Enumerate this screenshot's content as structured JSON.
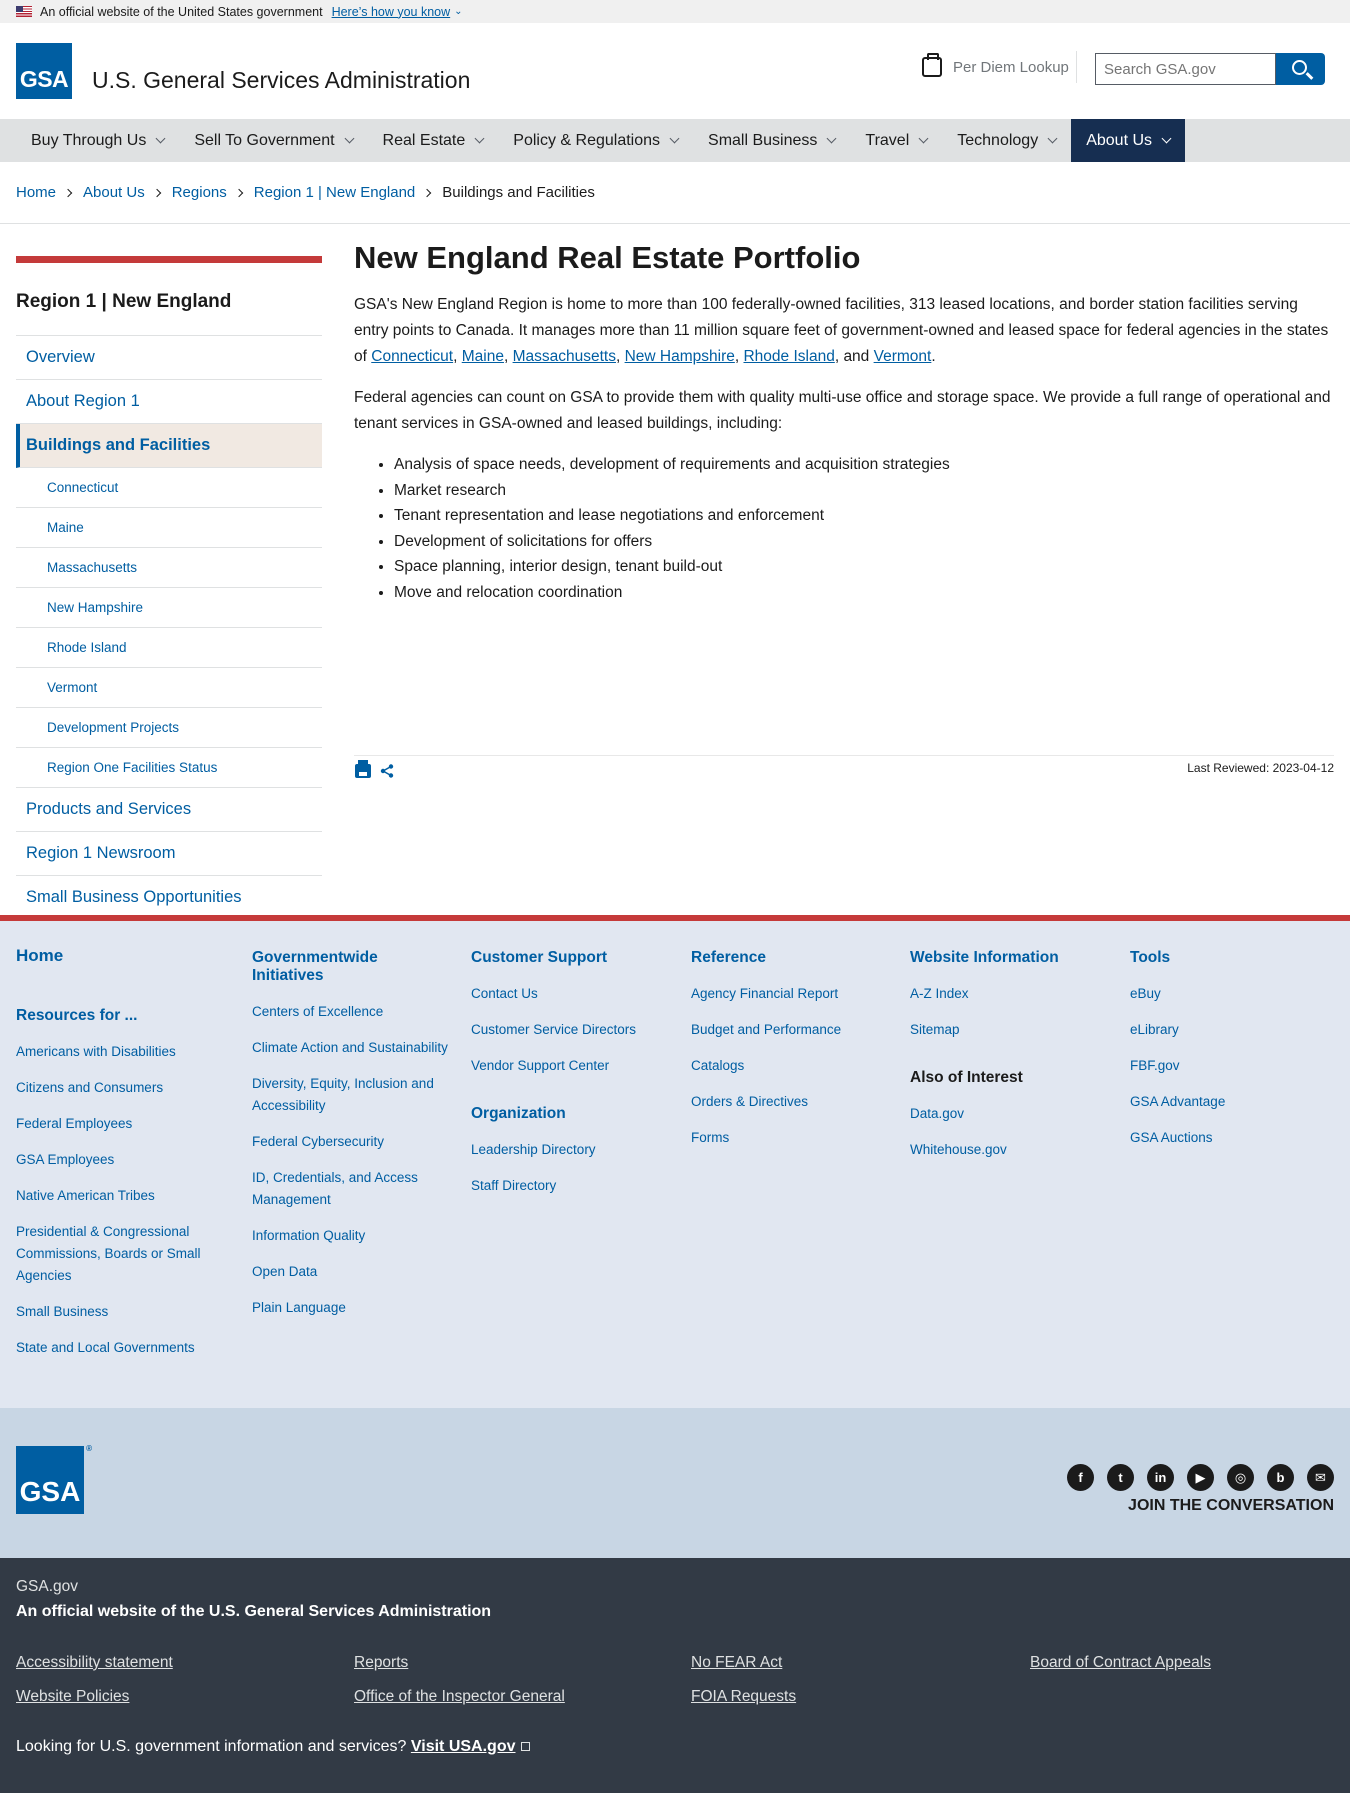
{
  "banner": {
    "text": "An official website of the United States government",
    "link": "Here’s how you know"
  },
  "header": {
    "logo": "GSA",
    "title": "U.S. General Services Administration",
    "perdiem": "Per Diem Lookup",
    "search_placeholder": "Search GSA.gov"
  },
  "nav": [
    "Buy Through Us",
    "Sell To Government",
    "Real Estate",
    "Policy & Regulations",
    "Small Business",
    "Travel",
    "Technology",
    "About Us"
  ],
  "breadcrumb": [
    "Home",
    "About Us",
    "Regions",
    "Region 1 | New England",
    "Buildings and Facilities"
  ],
  "sidenav": {
    "title": "Region 1 | New England",
    "items": [
      "Overview",
      "About Region 1",
      "Buildings and Facilities"
    ],
    "subitems": [
      "Connecticut",
      "Maine",
      "Massachusetts",
      "New Hampshire",
      "Rhode Island",
      "Vermont",
      "Development Projects",
      "Region One Facilities Status"
    ],
    "after": [
      "Products and Services",
      "Region 1 Newsroom",
      "Small Business Opportunities"
    ]
  },
  "main": {
    "title": "New England Real Estate Portfolio",
    "p1": "GSA's New England Region is home to more than 100 federally-owned facilities, 313 leased locations, and border station facilities serving entry points to Canada. It manages more than 11 million square feet of government-owned and leased space for federal agencies in the states of",
    "states": [
      "Connecticut",
      "Maine",
      "Massachusetts",
      "New Hampshire",
      "Rhode Island",
      "Vermont"
    ],
    "p2": "Federal agencies can count on GSA to provide them with quality multi-use office and storage space. We provide a full range of operational and tenant services in GSA-owned and leased buildings, including:",
    "bullets": [
      "Analysis of space needs, development of requirements and acquisition strategies",
      "Market research",
      "Tenant representation and lease negotiations and enforcement",
      "Development of solicitations for offers",
      "Space planning, interior design, tenant build-out",
      "Move and relocation coordination"
    ],
    "last_reviewed": "Last Reviewed: 2023-04-12"
  },
  "footer": {
    "home": "Home",
    "resources_title": "Resources for ...",
    "resources": [
      "Americans with Disabilities",
      "Citizens and Consumers",
      "Federal Employees",
      "GSA Employees",
      "Native American Tribes",
      "Presidential & Congressional Commissions, Boards or Small Agencies",
      "Small Business",
      "State and Local Governments"
    ],
    "gov_title": "Governmentwide Initiatives",
    "gov": [
      "Centers of Excellence",
      "Climate Action and Sustainability",
      "Diversity, Equity, Inclusion and Accessibility",
      "Federal Cybersecurity",
      "ID, Credentials, and Access Management",
      "Information Quality",
      "Open Data",
      "Plain Language"
    ],
    "cs_title": "Customer Support",
    "cs": [
      "Contact Us",
      "Customer Service Directors",
      "Vendor Support Center"
    ],
    "org_title": "Organization",
    "org": [
      "Leadership Directory",
      "Staff Directory"
    ],
    "ref_title": "Reference",
    "ref": [
      "Agency Financial Report",
      "Budget and Performance",
      "Catalogs",
      "Orders & Directives",
      "Forms"
    ],
    "web_title": "Website Information",
    "web": [
      "A-Z Index",
      "Sitemap"
    ],
    "interest_title": "Also of Interest",
    "interest": [
      "Data.gov",
      "Whitehouse.gov"
    ],
    "tools_title": "Tools",
    "tools": [
      "eBuy",
      "eLibrary",
      "FBF.gov",
      "GSA Advantage",
      "GSA Auctions"
    ]
  },
  "identifier": {
    "join": "JOIN THE CONVERSATION",
    "social": [
      "f",
      "t",
      "in",
      "▶",
      "◎",
      "b",
      "✉"
    ]
  },
  "bottom": {
    "gsagov": "GSA.gov",
    "official": "An official website of the U.S. General Services Administration",
    "links": [
      "Accessibility statement",
      "Reports",
      "No FEAR Act",
      "Board of Contract Appeals",
      "Website Policies",
      "Office of the Inspector General",
      "FOIA Requests"
    ],
    "usagov_text": "Looking for U.S. government information and services?",
    "usagov_link": "Visit USA.gov"
  }
}
